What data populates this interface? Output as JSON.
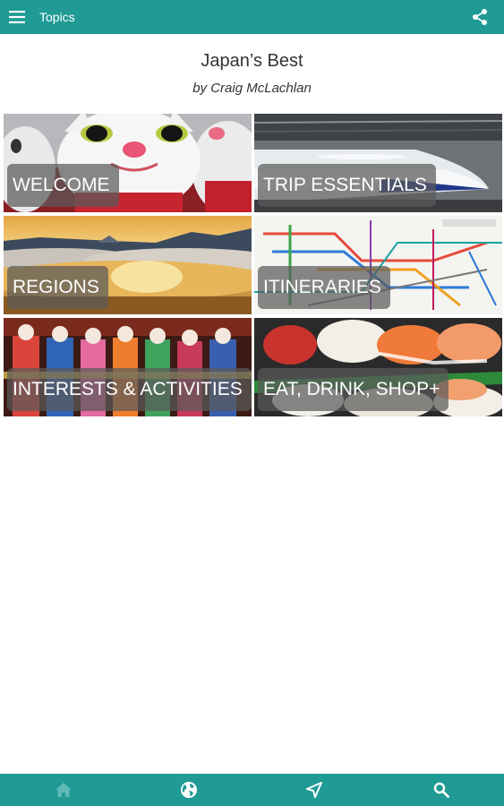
{
  "topbar": {
    "title": "Topics",
    "menu_icon": "hamburger-menu-icon",
    "share_icon": "share-icon",
    "color": "#1f9a95"
  },
  "header": {
    "title": "Japan’s Best",
    "author": "by Craig McLachlan"
  },
  "tiles": [
    {
      "label": "WELCOME",
      "image": "lucky-cat-figurines"
    },
    {
      "label": "TRIP ESSENTIALS",
      "image": "bullet-train-nose"
    },
    {
      "label": "REGIONS",
      "image": "mountains-above-clouds"
    },
    {
      "label": "ITINERARIES",
      "image": "rail-network-map"
    },
    {
      "label": "INTERESTS & ACTIVITIES",
      "image": "geisha-dancers"
    },
    {
      "label": "EAT, DRINK, SHOP+",
      "image": "sushi-platter"
    }
  ],
  "bottom_nav": {
    "items": [
      {
        "name": "home",
        "icon": "home-icon",
        "active": true
      },
      {
        "name": "globe",
        "icon": "globe-icon",
        "active": false
      },
      {
        "name": "locate",
        "icon": "location-arrow-icon",
        "active": false
      },
      {
        "name": "search",
        "icon": "search-icon",
        "active": false
      }
    ],
    "color": "#1f9a95"
  }
}
